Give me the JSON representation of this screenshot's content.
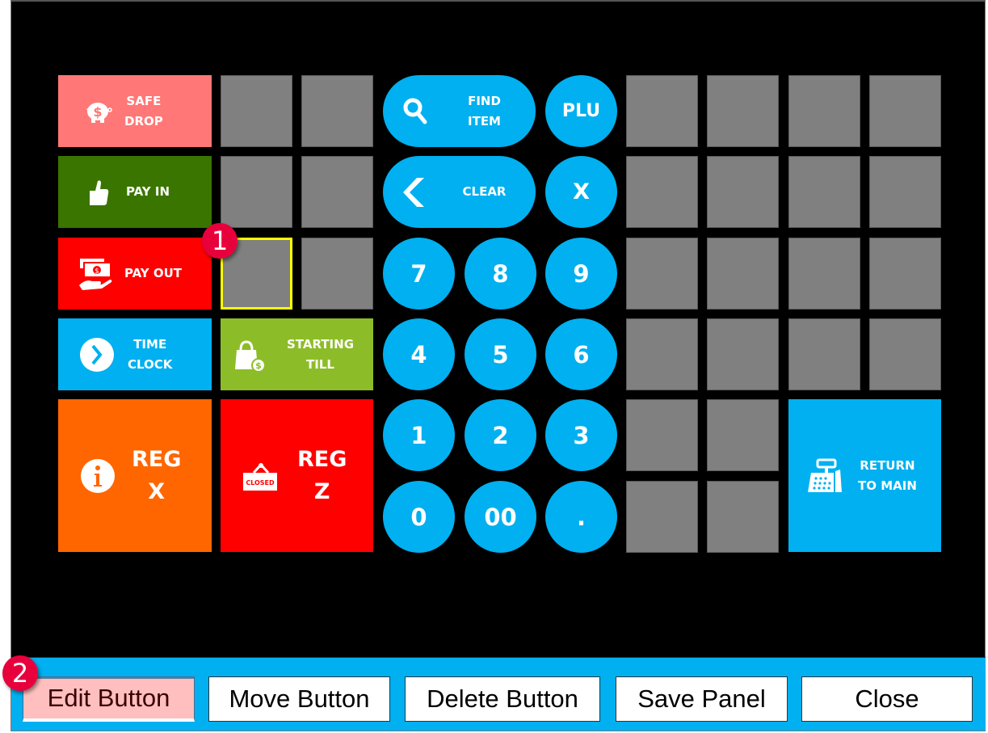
{
  "panel": {
    "colors": {
      "background": "#000000",
      "empty_slot": "#808080",
      "selected_outline": "#ffff00",
      "keypad": "#00b0f0",
      "badge": "#e8003d"
    },
    "function_buttons": {
      "safe_drop": {
        "label": "SAFE\nDROP",
        "icon": "piggy-bank-icon",
        "color": "#ff7777"
      },
      "pay_in": {
        "label": "PAY IN",
        "icon": "thumbs-up-icon",
        "color": "#3a7500"
      },
      "pay_out": {
        "label": "PAY OUT",
        "icon": "cash-hand-icon",
        "color": "#ff0000"
      },
      "time_clock": {
        "label": "TIME\nCLOCK",
        "icon": "clock-arrow-icon",
        "color": "#00b0f0"
      },
      "starting_till": {
        "label": "STARTING\nTILL",
        "icon": "shopping-bag-icon",
        "color": "#8cbd28"
      },
      "reg_x": {
        "label": "REG\nX",
        "icon": "info-icon",
        "color": "#ff6600"
      },
      "reg_z": {
        "label": "REG\nZ",
        "icon": "closed-sign-icon",
        "icon_text": "CLOSED",
        "color": "#ff0000"
      },
      "return_to_main": {
        "label": "RETURN\nTO MAIN",
        "icon": "cash-register-icon",
        "color": "#00b0f0"
      }
    },
    "keypad": {
      "find_item": "FIND\nITEM",
      "clear": "CLEAR",
      "plu": "PLU",
      "multiply": "X",
      "keys": [
        "7",
        "8",
        "9",
        "4",
        "5",
        "6",
        "1",
        "2",
        "3",
        "0",
        "00",
        "."
      ]
    }
  },
  "annotations": {
    "badge_1": "1",
    "badge_2": "2"
  },
  "toolbar": {
    "edit_button": "Edit Button",
    "move_button": "Move Button",
    "delete_button": "Delete Button",
    "save_panel": "Save Panel",
    "close": "Close",
    "active_item": "Edit Button"
  }
}
